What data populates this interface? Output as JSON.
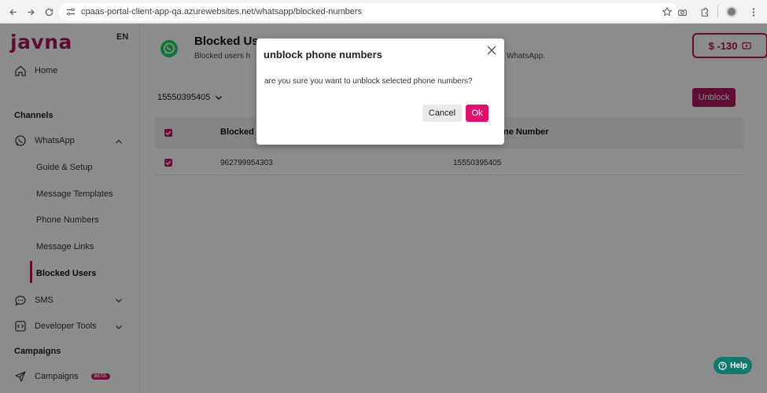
{
  "browser": {
    "url": "cpaas-portal-client-app-qa.azurewebsites.net/whatsapp/blocked-numbers"
  },
  "sidebar": {
    "logo": "javna",
    "lang": "EN",
    "home": "Home",
    "channels_title": "Channels",
    "whatsapp": "WhatsApp",
    "whatsapp_items": [
      "Guide & Setup",
      "Message Templates",
      "Phone Numbers",
      "Message Links",
      "Blocked Users"
    ],
    "sms": "SMS",
    "developer_tools": "Developer Tools",
    "campaigns_title": "Campaigns",
    "campaigns": "Campaigns",
    "beta_badge": "BETA"
  },
  "page": {
    "title": "Blocked Us",
    "description": "Blocked users h",
    "description_tail": "WhatsApp.",
    "balance": "$ -130",
    "filter_value": "15550395405",
    "unblock_label": "Unblock"
  },
  "table": {
    "columns": [
      "Blocked I",
      "ne Number"
    ],
    "rows": [
      {
        "blocked": "962799954303",
        "number": "15550395405"
      }
    ]
  },
  "help_label": "Help",
  "modal": {
    "title": "unblock phone numbers",
    "body": "are you sure you want to unblock selected phone numbers?",
    "cancel": "Cancel",
    "ok": "Ok"
  },
  "colors": {
    "brand": "#b0185c",
    "ok_button": "#e0106f",
    "help": "#127a6c"
  }
}
